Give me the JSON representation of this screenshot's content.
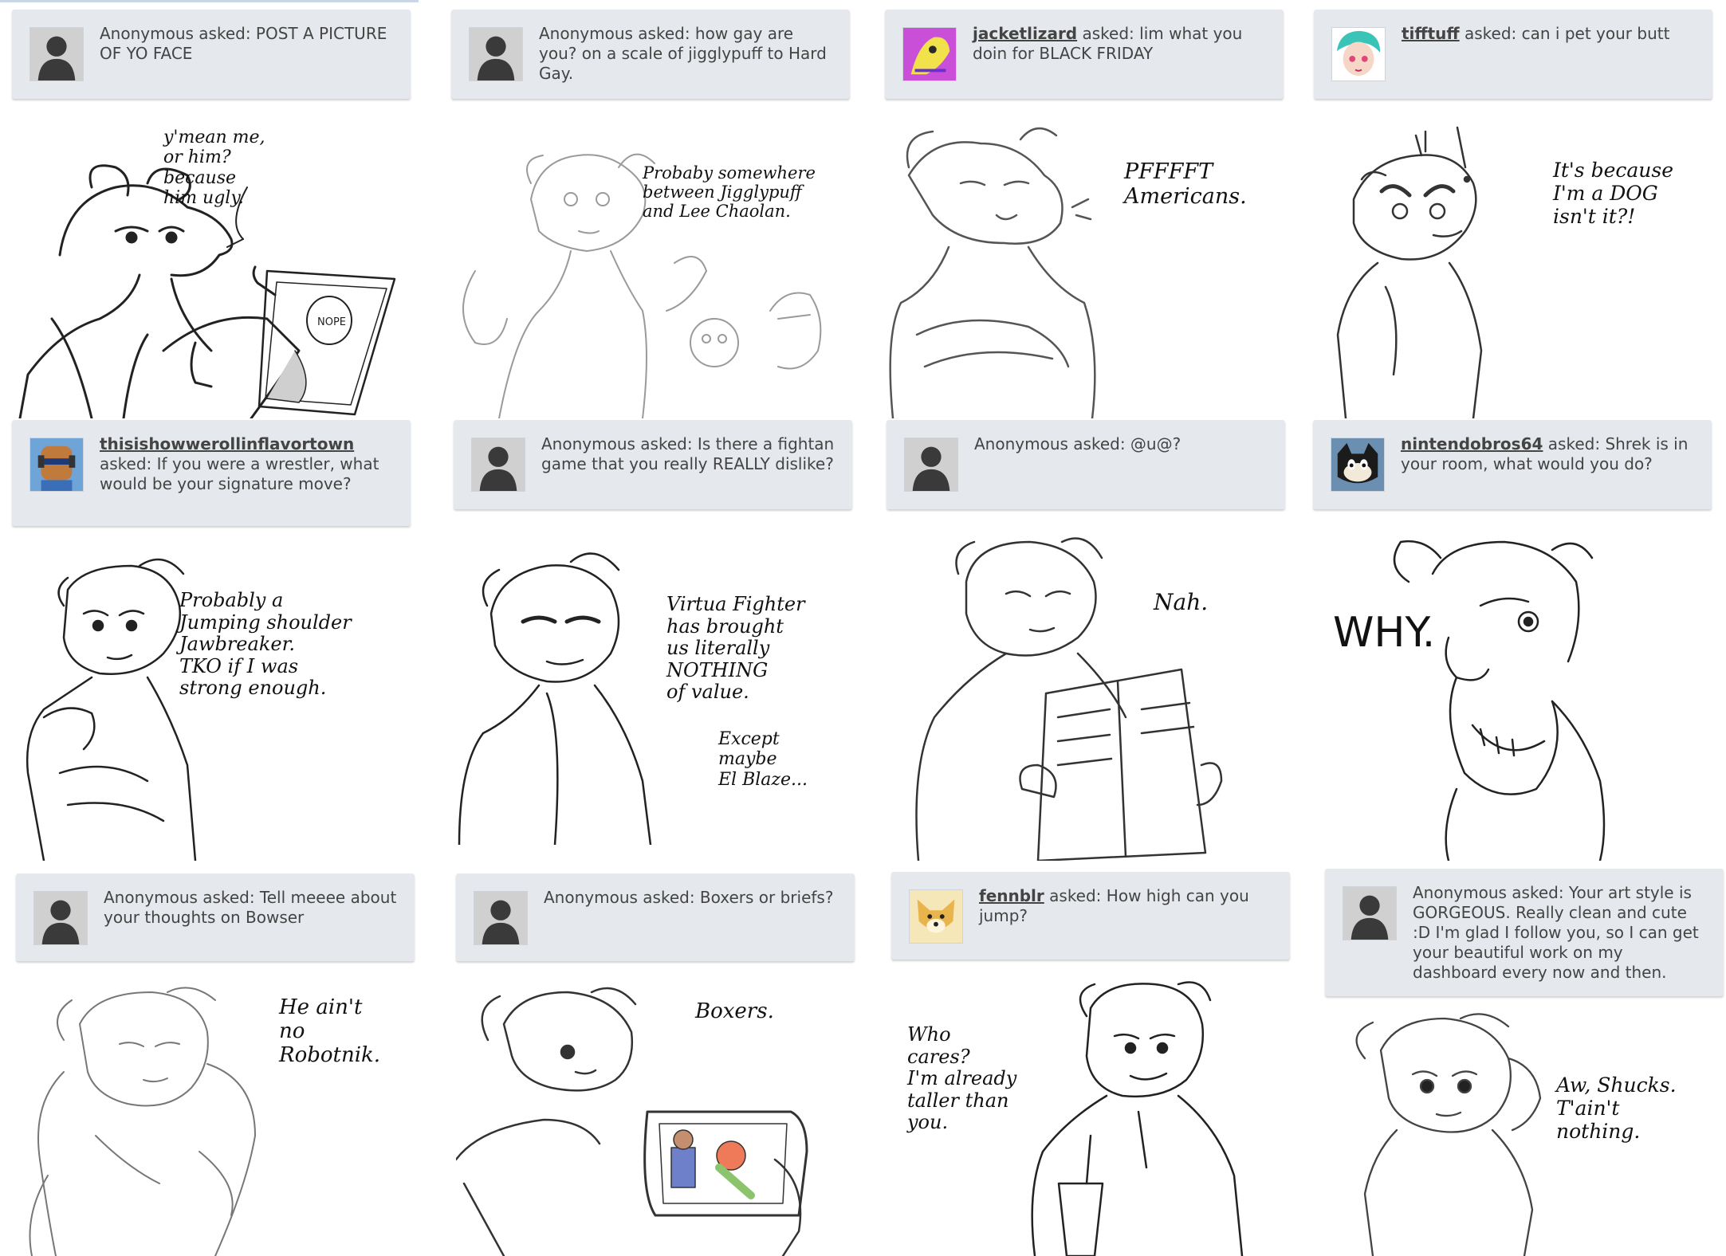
{
  "grid": [
    {
      "asker": "",
      "verb": "Anonymous asked:",
      "question": "POST A PICTURE OF YO FACE",
      "avatar_icon": "silhouette-avatar",
      "speech": "y'mean me,\nor him?\nbecause\nhim ugly.",
      "prop": "NOPE"
    },
    {
      "asker": "",
      "verb": "Anonymous asked:",
      "question": "how gay are you? on a scale of jigglypuff to Hard Gay.",
      "avatar_icon": "silhouette-avatar",
      "speech": "Probaby somewhere\nbetween Jigglypuff\nand Lee Chaolan."
    },
    {
      "asker": "jacketlizard",
      "verb": "asked:",
      "question": "lim what you doin for BLACK FRIDAY",
      "avatar_icon": "lizard-avatar",
      "speech": "PFFFFT\nAmericans."
    },
    {
      "asker": "tifftuff",
      "verb": "asked:",
      "question": "can i pet your butt",
      "avatar_icon": "girl-avatar",
      "speech": "It's because\nI'm a DOG\nisn't it?!"
    },
    {
      "asker": "thisishowwerollinflavortown",
      "verb": "asked:",
      "question": "If you were a wrestler, what would be your signature move?",
      "avatar_icon": "robot-avatar",
      "speech": "Probably a\nJumping shoulder\nJawbreaker.\nTKO if I was\nstrong enough."
    },
    {
      "asker": "",
      "verb": "Anonymous asked:",
      "question": "Is there a fightan game that you really REALLY dislike?",
      "avatar_icon": "silhouette-avatar",
      "speech": "Virtua Fighter\nhas brought\nus literally\nNOTHING\nof value.",
      "speech2": "Except\nmaybe\nEl Blaze..."
    },
    {
      "asker": "",
      "verb": "Anonymous asked:",
      "question": "@u@?",
      "avatar_icon": "silhouette-avatar",
      "speech": "Nah."
    },
    {
      "asker": "nintendobros64",
      "verb": "asked:",
      "question": "Shrek is in your room, what would you do?",
      "avatar_icon": "cat-avatar",
      "speech": "WHY."
    },
    {
      "asker": "",
      "verb": "Anonymous asked:",
      "question": "Tell meeee about your thoughts on Bowser",
      "avatar_icon": "silhouette-avatar",
      "speech": "He ain't\nno\nRobotnik."
    },
    {
      "asker": "",
      "verb": "Anonymous asked:",
      "question": "Boxers or briefs?",
      "avatar_icon": "silhouette-avatar",
      "speech": "Boxers."
    },
    {
      "asker": "fennblr",
      "verb": "asked:",
      "question": "How high can you jump?",
      "avatar_icon": "fox-avatar",
      "speech": "Who\ncares?\nI'm already\ntaller than\nyou."
    },
    {
      "asker": "",
      "verb": "Anonymous asked:",
      "question": "Your art style is GORGEOUS. Really clean and cute :D I'm glad I follow you, so I can get your beautiful work on my dashboard every now and then.",
      "avatar_icon": "silhouette-avatar",
      "speech": "Aw, Shucks.\nT'ain't\nnothing."
    }
  ]
}
